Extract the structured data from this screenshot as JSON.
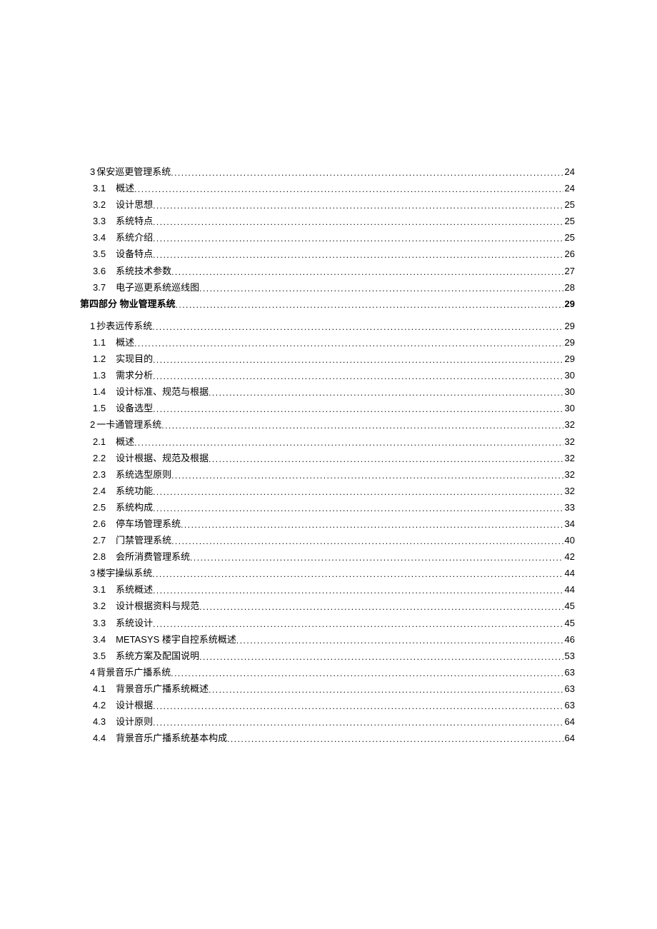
{
  "toc": [
    {
      "level": 2,
      "num": "3",
      "title": "保安巡更管理系统",
      "page": "24",
      "bold": false
    },
    {
      "level": 3,
      "num": "3.1",
      "title": "概述",
      "page": "24",
      "bold": false
    },
    {
      "level": 3,
      "num": "3.2",
      "title": "设计思想",
      "page": "25",
      "bold": false
    },
    {
      "level": 3,
      "num": "3.3",
      "title": "系统特点",
      "page": "25",
      "bold": false
    },
    {
      "level": 3,
      "num": "3.4",
      "title": "系统介绍",
      "page": "25",
      "bold": false
    },
    {
      "level": 3,
      "num": "3.5",
      "title": "设备特点",
      "page": "26",
      "bold": false
    },
    {
      "level": 3,
      "num": "3.6",
      "title": "系统技术参数",
      "page": "27",
      "bold": false
    },
    {
      "level": 3,
      "num": "3.7",
      "title": "电子巡更系统巡线图",
      "page": "28",
      "bold": false
    },
    {
      "level": 1,
      "num": "",
      "title": "第四部分 物业管理系统",
      "page": "29",
      "bold": true,
      "spacer": true
    },
    {
      "level": 2,
      "num": "1",
      "title": "抄表远传系统",
      "page": "29",
      "bold": false
    },
    {
      "level": 3,
      "num": "1.1",
      "title": "概述",
      "page": "29",
      "bold": false
    },
    {
      "level": 3,
      "num": "1.2",
      "title": "实现目的",
      "page": "29",
      "bold": false
    },
    {
      "level": 3,
      "num": "1.3",
      "title": "需求分析",
      "page": "30",
      "bold": false
    },
    {
      "level": 3,
      "num": "1.4",
      "title": "设计标准、规范与根据",
      "page": "30",
      "bold": false
    },
    {
      "level": 3,
      "num": "1.5",
      "title": "设备选型",
      "page": "30",
      "bold": false
    },
    {
      "level": 2,
      "num": "2",
      "title": "一卡通管理系统",
      "page": "32",
      "bold": false
    },
    {
      "level": 3,
      "num": "2.1",
      "title": "概述",
      "page": "32",
      "bold": false
    },
    {
      "level": 3,
      "num": "2.2",
      "title": "设计根据、规范及根据",
      "page": "32",
      "bold": false
    },
    {
      "level": 3,
      "num": "2.3",
      "title": "系统选型原则",
      "page": "32",
      "bold": false
    },
    {
      "level": 3,
      "num": "2.4",
      "title": "系统功能",
      "page": "32",
      "bold": false
    },
    {
      "level": 3,
      "num": "2.5",
      "title": "系统构成",
      "page": "33",
      "bold": false
    },
    {
      "level": 3,
      "num": "2.6",
      "title": "停车场管理系统",
      "page": "34",
      "bold": false
    },
    {
      "level": 3,
      "num": "2.7",
      "title": "门禁管理系统",
      "page": "40",
      "bold": false
    },
    {
      "level": 3,
      "num": "2.8",
      "title": "会所消费管理系统",
      "page": "42",
      "bold": false
    },
    {
      "level": 2,
      "num": "3",
      "title": "楼宇操纵系统",
      "page": "44",
      "bold": false
    },
    {
      "level": 3,
      "num": "3.1",
      "title": "系统概述",
      "page": "44",
      "bold": false
    },
    {
      "level": 3,
      "num": "3.2",
      "title": "设计根据资料与规范",
      "page": "45",
      "bold": false
    },
    {
      "level": 3,
      "num": "3.3",
      "title": "系统设计",
      "page": "45",
      "bold": false
    },
    {
      "level": 3,
      "num": "3.4",
      "title": "METASYS 楼宇自控系统概述",
      "page": "46",
      "bold": false
    },
    {
      "level": 3,
      "num": "3.5",
      "title": "系统方案及配国说明",
      "page": "53",
      "bold": false
    },
    {
      "level": 2,
      "num": "4",
      "title": "背景音乐广播系统",
      "page": "63",
      "bold": false
    },
    {
      "level": 3,
      "num": "4.1",
      "title": "背景音乐广播系统概述",
      "page": "63",
      "bold": false
    },
    {
      "level": 3,
      "num": "4.2",
      "title": "设计根据",
      "page": "63",
      "bold": false
    },
    {
      "level": 3,
      "num": "4.3",
      "title": "设计原则",
      "page": "64",
      "bold": false
    },
    {
      "level": 3,
      "num": "4.4",
      "title": "背景音乐广播系统基本构成",
      "page": "64",
      "bold": false
    }
  ]
}
